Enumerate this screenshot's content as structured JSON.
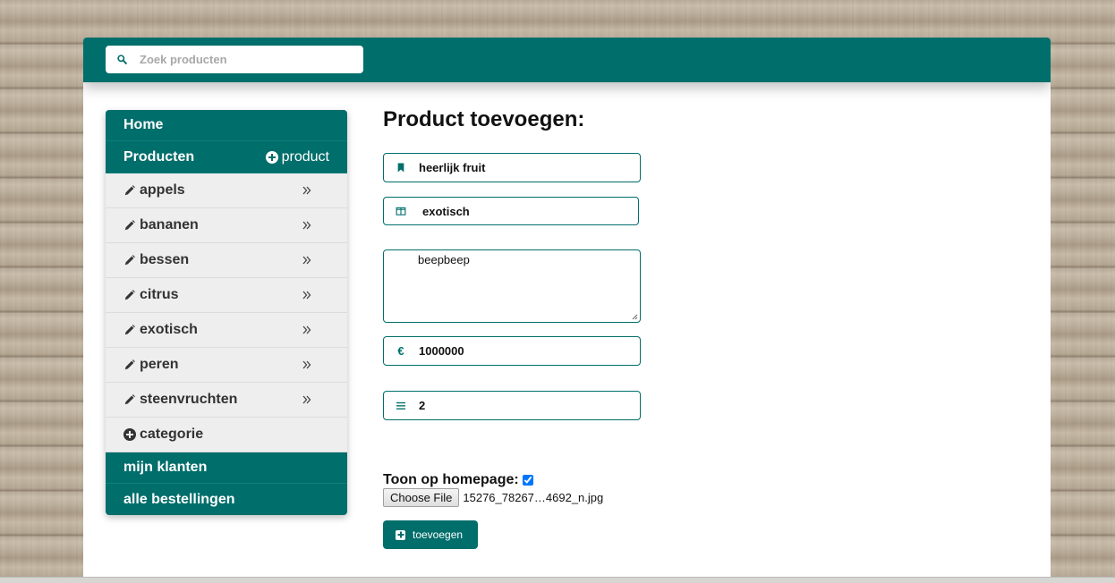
{
  "search": {
    "placeholder": "Zoek producten"
  },
  "sidebar": {
    "home": "Home",
    "producten": "Producten",
    "add_product": "product",
    "categories": [
      "appels",
      "bananen",
      "bessen",
      "citrus",
      "exotisch",
      "peren",
      "steenvruchten"
    ],
    "add_category": "categorie",
    "klanten": "mijn klanten",
    "bestellingen": "alle bestellingen"
  },
  "form": {
    "title": "Product toevoegen:",
    "name": "heerlijk fruit",
    "category": "exotisch",
    "description": "beepbeep",
    "price_icon": "€",
    "price": "1000000",
    "quantity": "2",
    "homepage_label": "Toon op homepage:",
    "homepage_checked": true,
    "file_button": "Choose File",
    "file_name": "15276_78267…4692_n.jpg",
    "submit_label": "toevoegen"
  },
  "colors": {
    "accent": "#006e6b",
    "sidebar_bg": "#eeeeee"
  },
  "icons": {
    "search": "search-icon",
    "bookmark": "bookmark-icon",
    "columns": "columns-icon",
    "euro": "euro-icon",
    "list": "list-icon",
    "pencil": "pencil-icon",
    "chevrons": "double-chevron-right-icon",
    "plus_circle": "plus-circle-icon",
    "plus_square": "plus-square-icon"
  }
}
